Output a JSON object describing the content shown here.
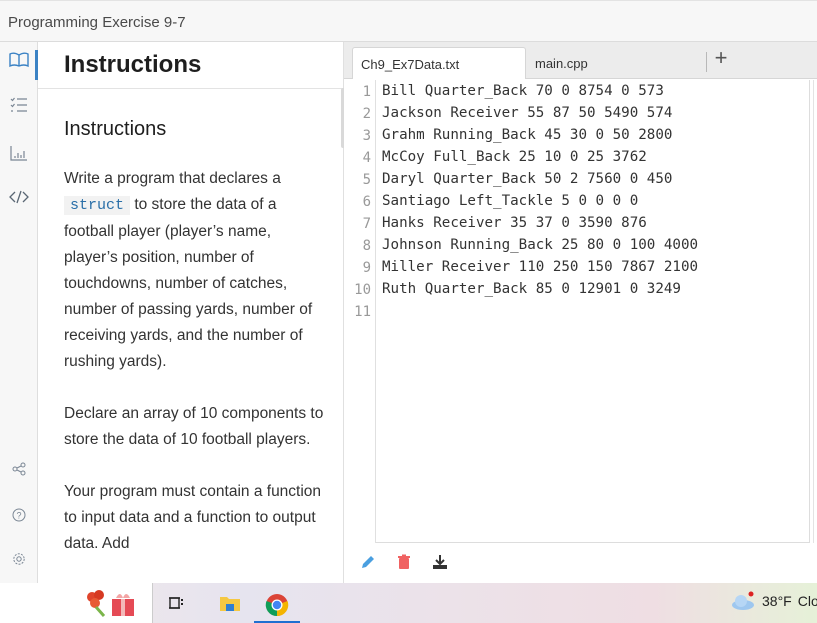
{
  "window": {
    "title": "Programming Exercise 9-7"
  },
  "rail": {
    "items": [
      {
        "icon": "book-icon",
        "active": true
      },
      {
        "icon": "checklist-icon",
        "active": false
      },
      {
        "icon": "chart-icon",
        "active": false
      },
      {
        "icon": "code-icon",
        "active": false
      },
      {
        "icon": "share-icon",
        "active": false
      },
      {
        "icon": "help-icon",
        "active": false
      },
      {
        "icon": "settings-icon",
        "active": false
      }
    ]
  },
  "instructions": {
    "panel_title": "Instructions",
    "heading": "Instructions",
    "p1_before": "Write a program that declares a",
    "p1_code": "struct",
    "p1_after": "to store the data of a football player (player’s name, player’s position, number of touchdowns, number of catches, number of passing yards, number of receiving yards, and the number of rushing yards).",
    "p2": "Declare an array of 10 components to store the data of 10 football players.",
    "p3": "Your program must contain a function to input data and a function to output data. Add"
  },
  "editor": {
    "tabs": [
      {
        "label": "Ch9_Ex7Data.txt",
        "active": true
      },
      {
        "label": "main.cpp",
        "active": false
      }
    ],
    "add_tab_label": "+",
    "line_numbers": [
      "1",
      "2",
      "3",
      "4",
      "5",
      "6",
      "7",
      "8",
      "9",
      "10",
      "11"
    ],
    "lines": [
      "Bill Quarter_Back 70 0 8754 0 573",
      "Jackson Receiver 55 87 50 5490 574",
      "Grahm Running_Back 45 30 0 50 2800",
      "McCoy Full_Back 25 10 0 25 3762",
      "Daryl Quarter_Back 50 2 7560 0 450",
      "Santiago Left_Tackle 5 0 0 0 0",
      "Hanks Receiver 35 37 0 3590 876",
      "Johnson Running_Back 25 80 0 100 4000",
      "Miller Receiver 110 250 150 7867 2100",
      "Ruth Quarter_Back 85 0 12901 0 3249",
      ""
    ],
    "tools": [
      "pencil-icon",
      "trash-icon",
      "download-icon"
    ],
    "colors": {
      "pencil": "#4a9fe0",
      "trash": "#f06262",
      "download": "#333333"
    }
  },
  "taskbar": {
    "weather_temp": "38°F",
    "weather_text": "Clo"
  }
}
